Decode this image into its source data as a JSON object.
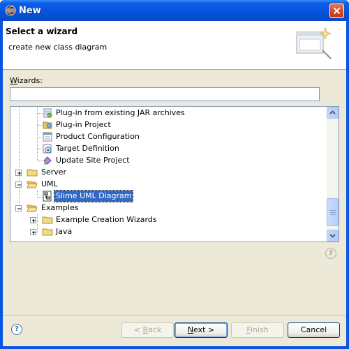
{
  "window": {
    "title": "New"
  },
  "header": {
    "title": "Select a wizard",
    "description": "create new class diagram"
  },
  "wizards_label_first": "W",
  "wizards_label_rest": "izards:",
  "filter": {
    "value": "",
    "placeholder": ""
  },
  "tree": {
    "items": [
      {
        "label": "Plug-in from existing JAR archives",
        "icon": "jar-plugin-icon"
      },
      {
        "label": "Plug-in Project",
        "icon": "plugin-project-icon"
      },
      {
        "label": "Product Configuration",
        "icon": "product-config-icon"
      },
      {
        "label": "Target Definition",
        "icon": "target-definition-icon"
      },
      {
        "label": "Update Site Project",
        "icon": "update-site-icon"
      },
      {
        "label": "Server",
        "icon": "folder-icon"
      },
      {
        "label": "UML",
        "icon": "folder-open-icon"
      },
      {
        "label": "Slime UML Diagram",
        "icon": "uml-diagram-icon",
        "selected": true
      },
      {
        "label": "Examples",
        "icon": "folder-open-icon"
      },
      {
        "label": "Example Creation Wizards",
        "icon": "folder-icon"
      },
      {
        "label": "Java",
        "icon": "folder-icon"
      }
    ]
  },
  "buttons": {
    "back_prefix": "< ",
    "back_acc": "B",
    "back_rest": "ack",
    "next_acc": "N",
    "next_rest": "ext >",
    "finish_acc": "F",
    "finish_rest": "inish",
    "cancel": "Cancel"
  },
  "help_glyph": "?",
  "colors": {
    "selection": "#316ac5",
    "titlebar": "#0553db",
    "dialog_bg": "#ece9d8"
  }
}
